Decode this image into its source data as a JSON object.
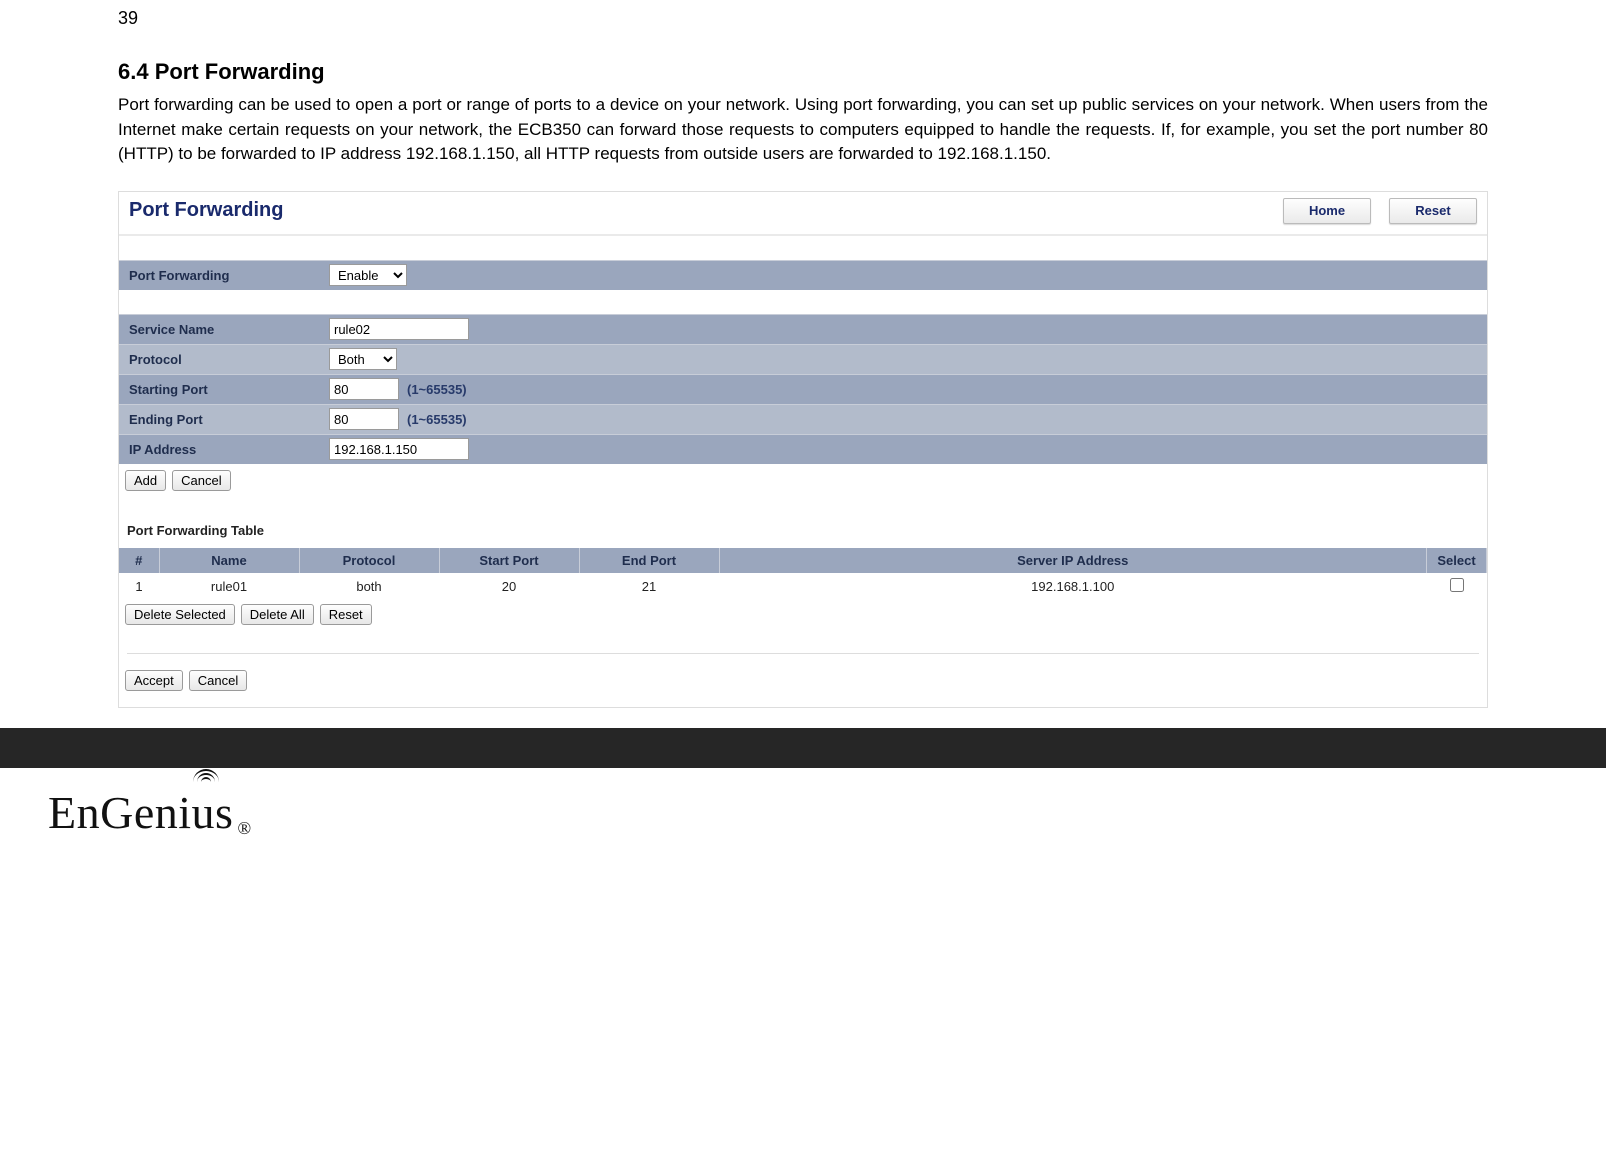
{
  "page_number": "39",
  "heading": "6.4   Port Forwarding",
  "intro": "Port forwarding can be used to open a port or range of ports to a device on your network. Using port forwarding, you can set up public services on your network. When users from the Internet make certain requests on your network, the ECB350 can forward those requests to computers equipped to handle the requests. If, for example, you set the port number 80 (HTTP) to be forwarded to IP address 192.168.1.150, all HTTP requests from outside users are forwarded to 192.168.1.150.",
  "panel": {
    "title": "Port Forwarding",
    "home_btn": "Home",
    "reset_btn": "Reset"
  },
  "form": {
    "pf_label": "Port Forwarding",
    "pf_value": "Enable",
    "service_label": "Service Name",
    "service_value": "rule02",
    "protocol_label": "Protocol",
    "protocol_value": "Both",
    "start_label": "Starting Port",
    "start_value": "80",
    "start_hint": "(1~65535)",
    "end_label": "Ending Port",
    "end_value": "80",
    "end_hint": "(1~65535)",
    "ip_label": "IP Address",
    "ip_value": "192.168.1.150",
    "add_btn": "Add",
    "cancel_btn": "Cancel"
  },
  "table": {
    "title": "Port Forwarding Table",
    "headers": {
      "num": "#",
      "name": "Name",
      "protocol": "Protocol",
      "start": "Start Port",
      "end": "End Port",
      "server": "Server IP Address",
      "select": "Select"
    },
    "rows": [
      {
        "num": "1",
        "name": "rule01",
        "protocol": "both",
        "start": "20",
        "end": "21",
        "server": "192.168.1.100"
      }
    ],
    "delete_selected": "Delete Selected",
    "delete_all": "Delete All",
    "reset": "Reset"
  },
  "bottom": {
    "accept": "Accept",
    "cancel": "Cancel"
  },
  "logo": {
    "text_a": "EnGen",
    "text_b": "ius",
    "reg": "®"
  }
}
